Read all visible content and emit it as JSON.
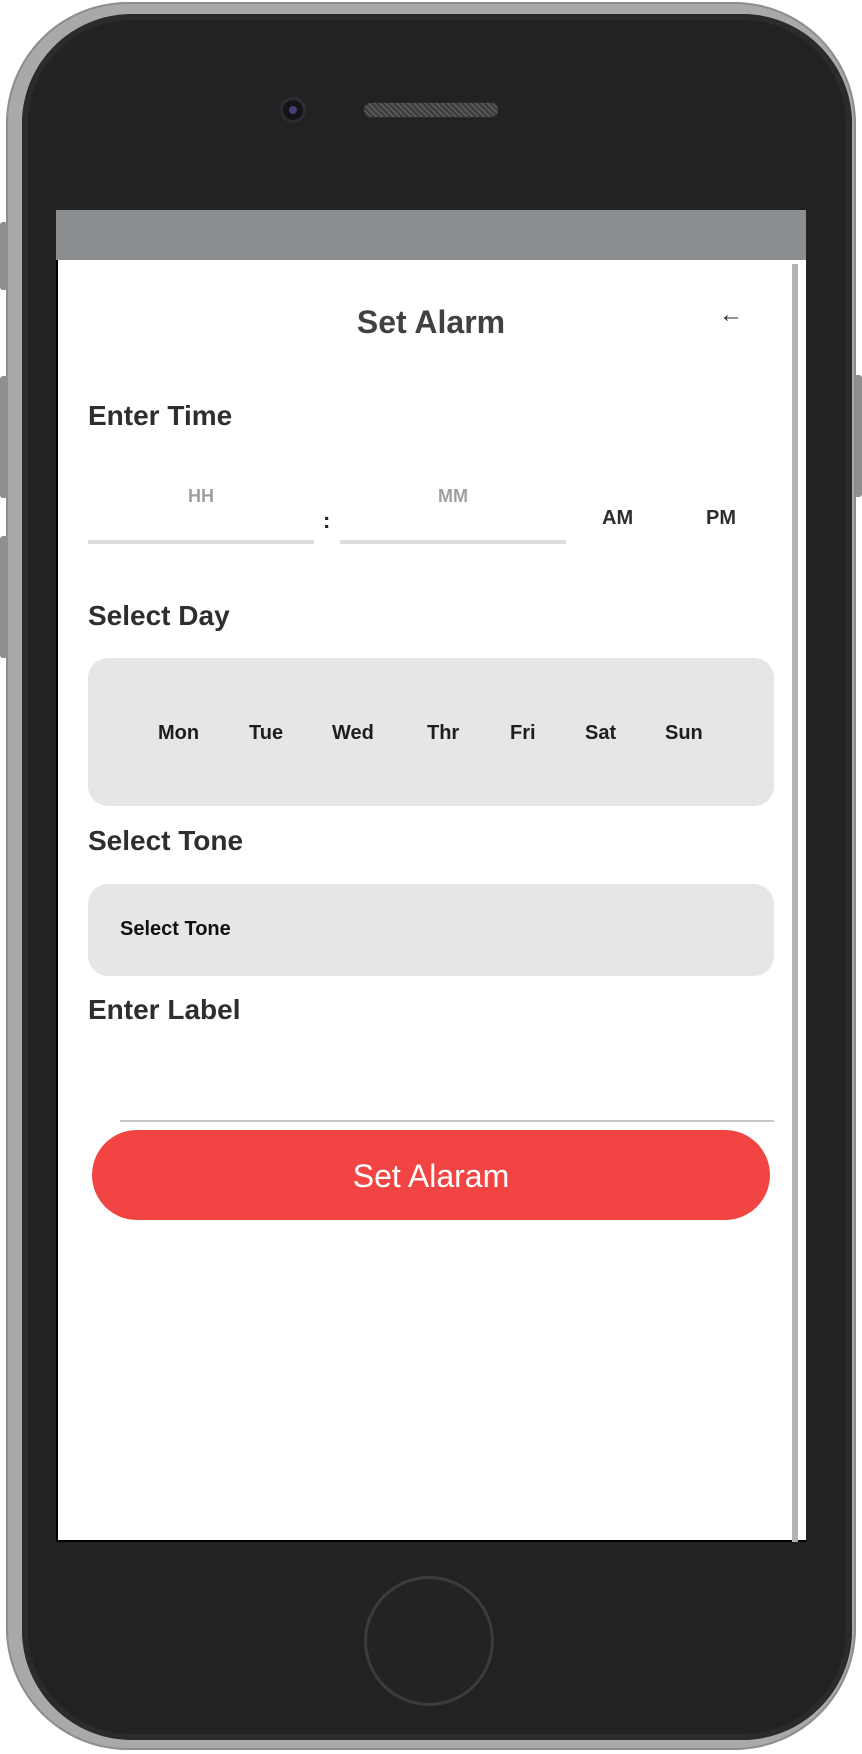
{
  "header": {
    "title": "Set Alarm",
    "back_icon": "←"
  },
  "time": {
    "section_label": "Enter Time",
    "hour_placeholder": "HH",
    "minute_placeholder": "MM",
    "separator": ":",
    "am_label": "AM",
    "pm_label": "PM"
  },
  "days": {
    "section_label": "Select Day",
    "items": [
      "Mon",
      "Tue",
      "Wed",
      "Thr",
      "Fri",
      "Sat",
      "Sun"
    ]
  },
  "tone": {
    "section_label": "Select Tone",
    "selected_value": "Select Tone"
  },
  "label": {
    "section_label": "Enter Label",
    "value": ""
  },
  "actions": {
    "set_button_label": "Set Alaram"
  },
  "colors": {
    "accent": "#f24543",
    "panel": "#e5e6e8",
    "status_strip": "#8b8e91"
  }
}
